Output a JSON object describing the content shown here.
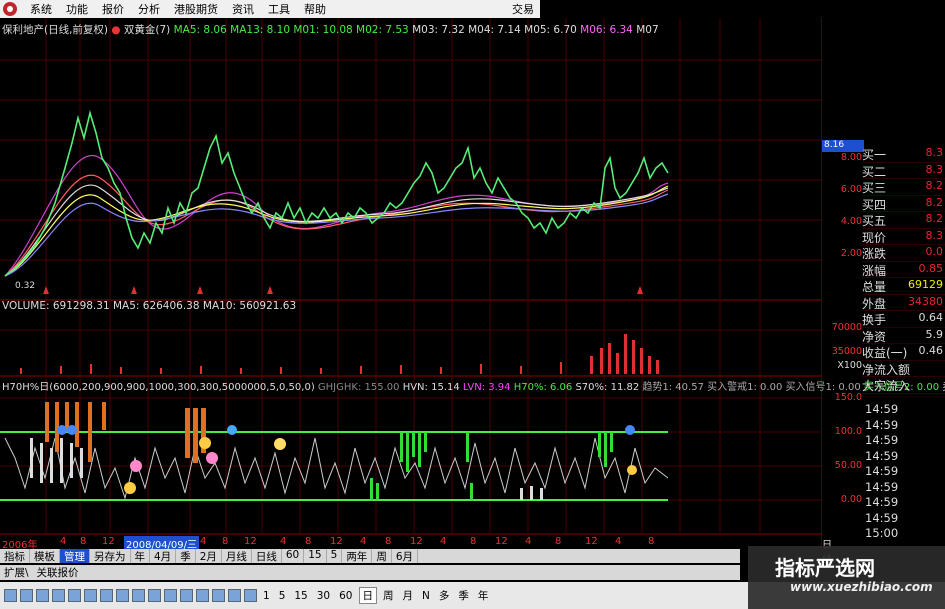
{
  "menubar": {
    "items": [
      "系统",
      "功能",
      "报价",
      "分析",
      "港股期货",
      "资讯",
      "工具",
      "帮助"
    ],
    "right": "交易"
  },
  "title_line": {
    "stock": "保利地产(日线,前复权)",
    "indicator": "双黄金(7)",
    "ma5": "MA5: 8.06",
    "ma13": "MA13: 8.10",
    "m01": "M01: 10.08",
    "m02": "M02: 7.53",
    "m03": "M03: 7.32",
    "m04": "M04: 7.14",
    "m05": "M05: 6.70",
    "m06": "M06: 6.34",
    "m07": "M07"
  },
  "price_axis": {
    "current": "8.16",
    "labels": [
      "8.00",
      "6.00",
      "4.00",
      "2.00"
    ],
    "low": "0.32"
  },
  "volume": {
    "label": "VOLUME: 691298.31",
    "ma5": "MA5: 626406.38",
    "ma10": "MA10: 560921.63",
    "axis": [
      "70000",
      "35000",
      "X100"
    ]
  },
  "indicator_line": {
    "text1": "H70H%日(6000,200,900,900,1000,300,300,5000000,5,0,50,0)",
    "ghjghk": "GHJGHK: 155.00",
    "hvn": "HVN: 15.14",
    "lvn": "LVN: 3.94",
    "h70": "H70%: 6.06",
    "s70": "S70%: 11.82",
    "trend": "趋势1: 40.57",
    "buy": "买入警戒1: 0.00",
    "sig1": "买入信号1: 0.00",
    "sig2": "买入信号2: 0.00",
    "more": "卖",
    "axis": [
      "150.0",
      "100.0",
      "50.00",
      "0.00"
    ]
  },
  "dates": {
    "year_start": "2006年",
    "selected": "2008/04/09/三",
    "ticks": [
      "4",
      "8",
      "12",
      "4",
      "8",
      "12",
      "4",
      "8",
      "12",
      "4",
      "8",
      "12",
      "4",
      "8",
      "12",
      "4",
      "8",
      "12",
      "4",
      "8"
    ],
    "right": "日线"
  },
  "quote": {
    "rows": [
      {
        "k": "买一",
        "v": "8.3"
      },
      {
        "k": "买二",
        "v": "8.3"
      },
      {
        "k": "买三",
        "v": "8.2"
      },
      {
        "k": "买四",
        "v": "8.2"
      },
      {
        "k": "买五",
        "v": "8.2"
      },
      {
        "k": "现价",
        "v": "8.3"
      },
      {
        "k": "涨跌",
        "v": "0.0"
      },
      {
        "k": "涨幅",
        "v": "0.85"
      },
      {
        "k": "总量",
        "v": "69129"
      },
      {
        "k": "外盘",
        "v": "34380"
      },
      {
        "k": "换手",
        "v": "0.64"
      },
      {
        "k": "净资",
        "v": "5.9"
      },
      {
        "k": "收益(一)",
        "v": "0.46"
      },
      {
        "k": "净流入额",
        "v": ""
      },
      {
        "k": "大宗流入",
        "v": ""
      }
    ],
    "times": [
      "14:59",
      "14:59",
      "14:59",
      "14:59",
      "14:59",
      "14:59",
      "14:59",
      "14:59",
      "15:00"
    ]
  },
  "bottom_tabs1": [
    "指标",
    "模板",
    "管理",
    "另存为",
    "年",
    "4月",
    "季",
    "2月",
    "月线",
    "日线",
    "60",
    "15",
    "5",
    "两年",
    "周",
    "6月"
  ],
  "bottom_tabs2": [
    "扩展\\",
    "关联报价"
  ],
  "toolbar": {
    "nums": [
      "1",
      "5",
      "15",
      "30",
      "60",
      "日",
      "周",
      "月",
      "N",
      "多",
      "季",
      "年"
    ]
  },
  "watermark": {
    "name": "指标严选网",
    "url": "www.xuezhibiao.com"
  },
  "colors": {
    "up": "#ff3333",
    "down": "#44ee44",
    "grid": "#5a0000",
    "accent": "#1e4fd1"
  }
}
